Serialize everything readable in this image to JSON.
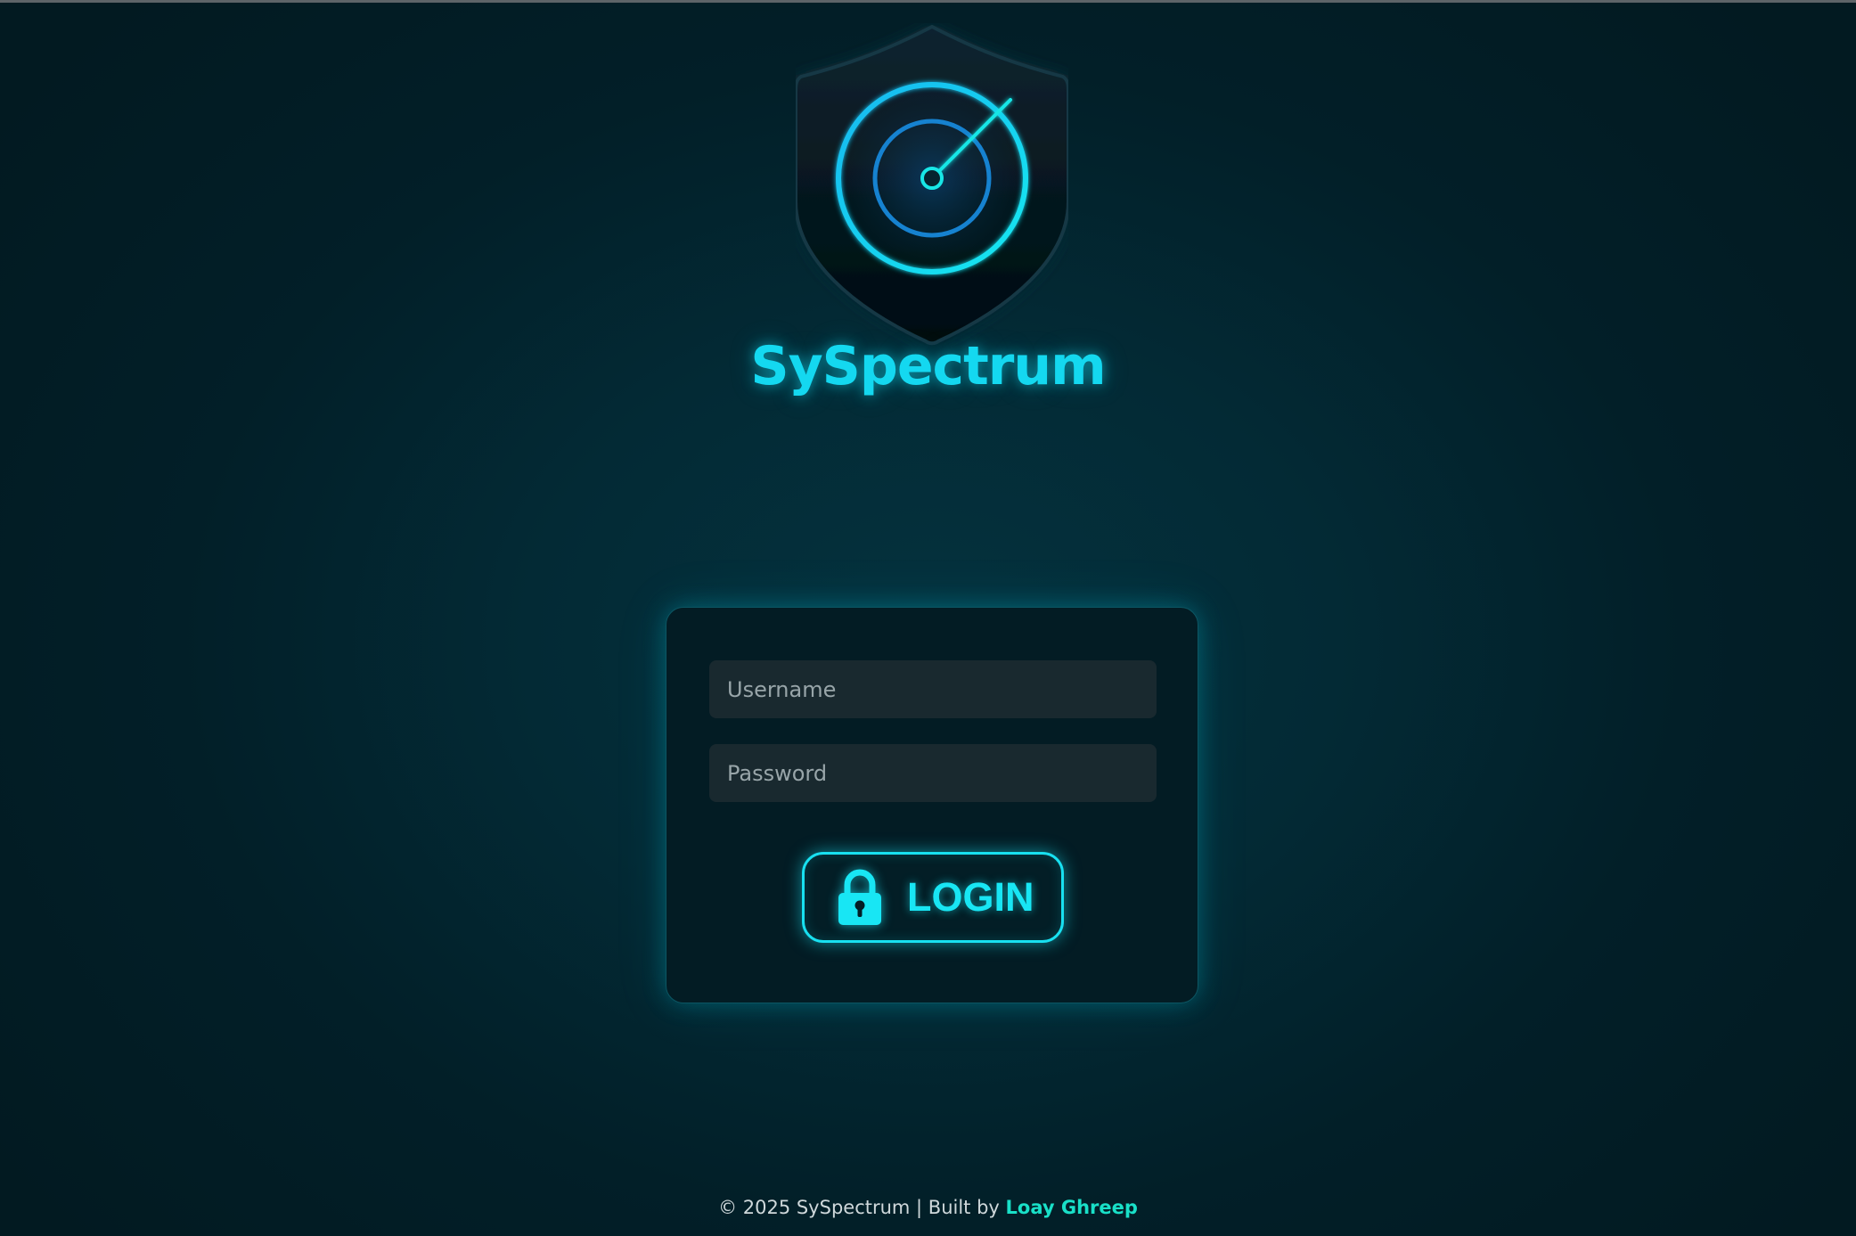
{
  "brand": {
    "name": "SySpectrum",
    "logo_icon": "shield-radar-icon",
    "accent_color": "#14d8f0"
  },
  "login_form": {
    "username_placeholder": "Username",
    "password_placeholder": "Password",
    "submit_label": "LOGIN",
    "submit_icon": "lock-icon"
  },
  "footer": {
    "text": "© 2025 SySpectrum | Built by ",
    "author": "Loay Ghreep",
    "author_color": "#19e0c8"
  }
}
